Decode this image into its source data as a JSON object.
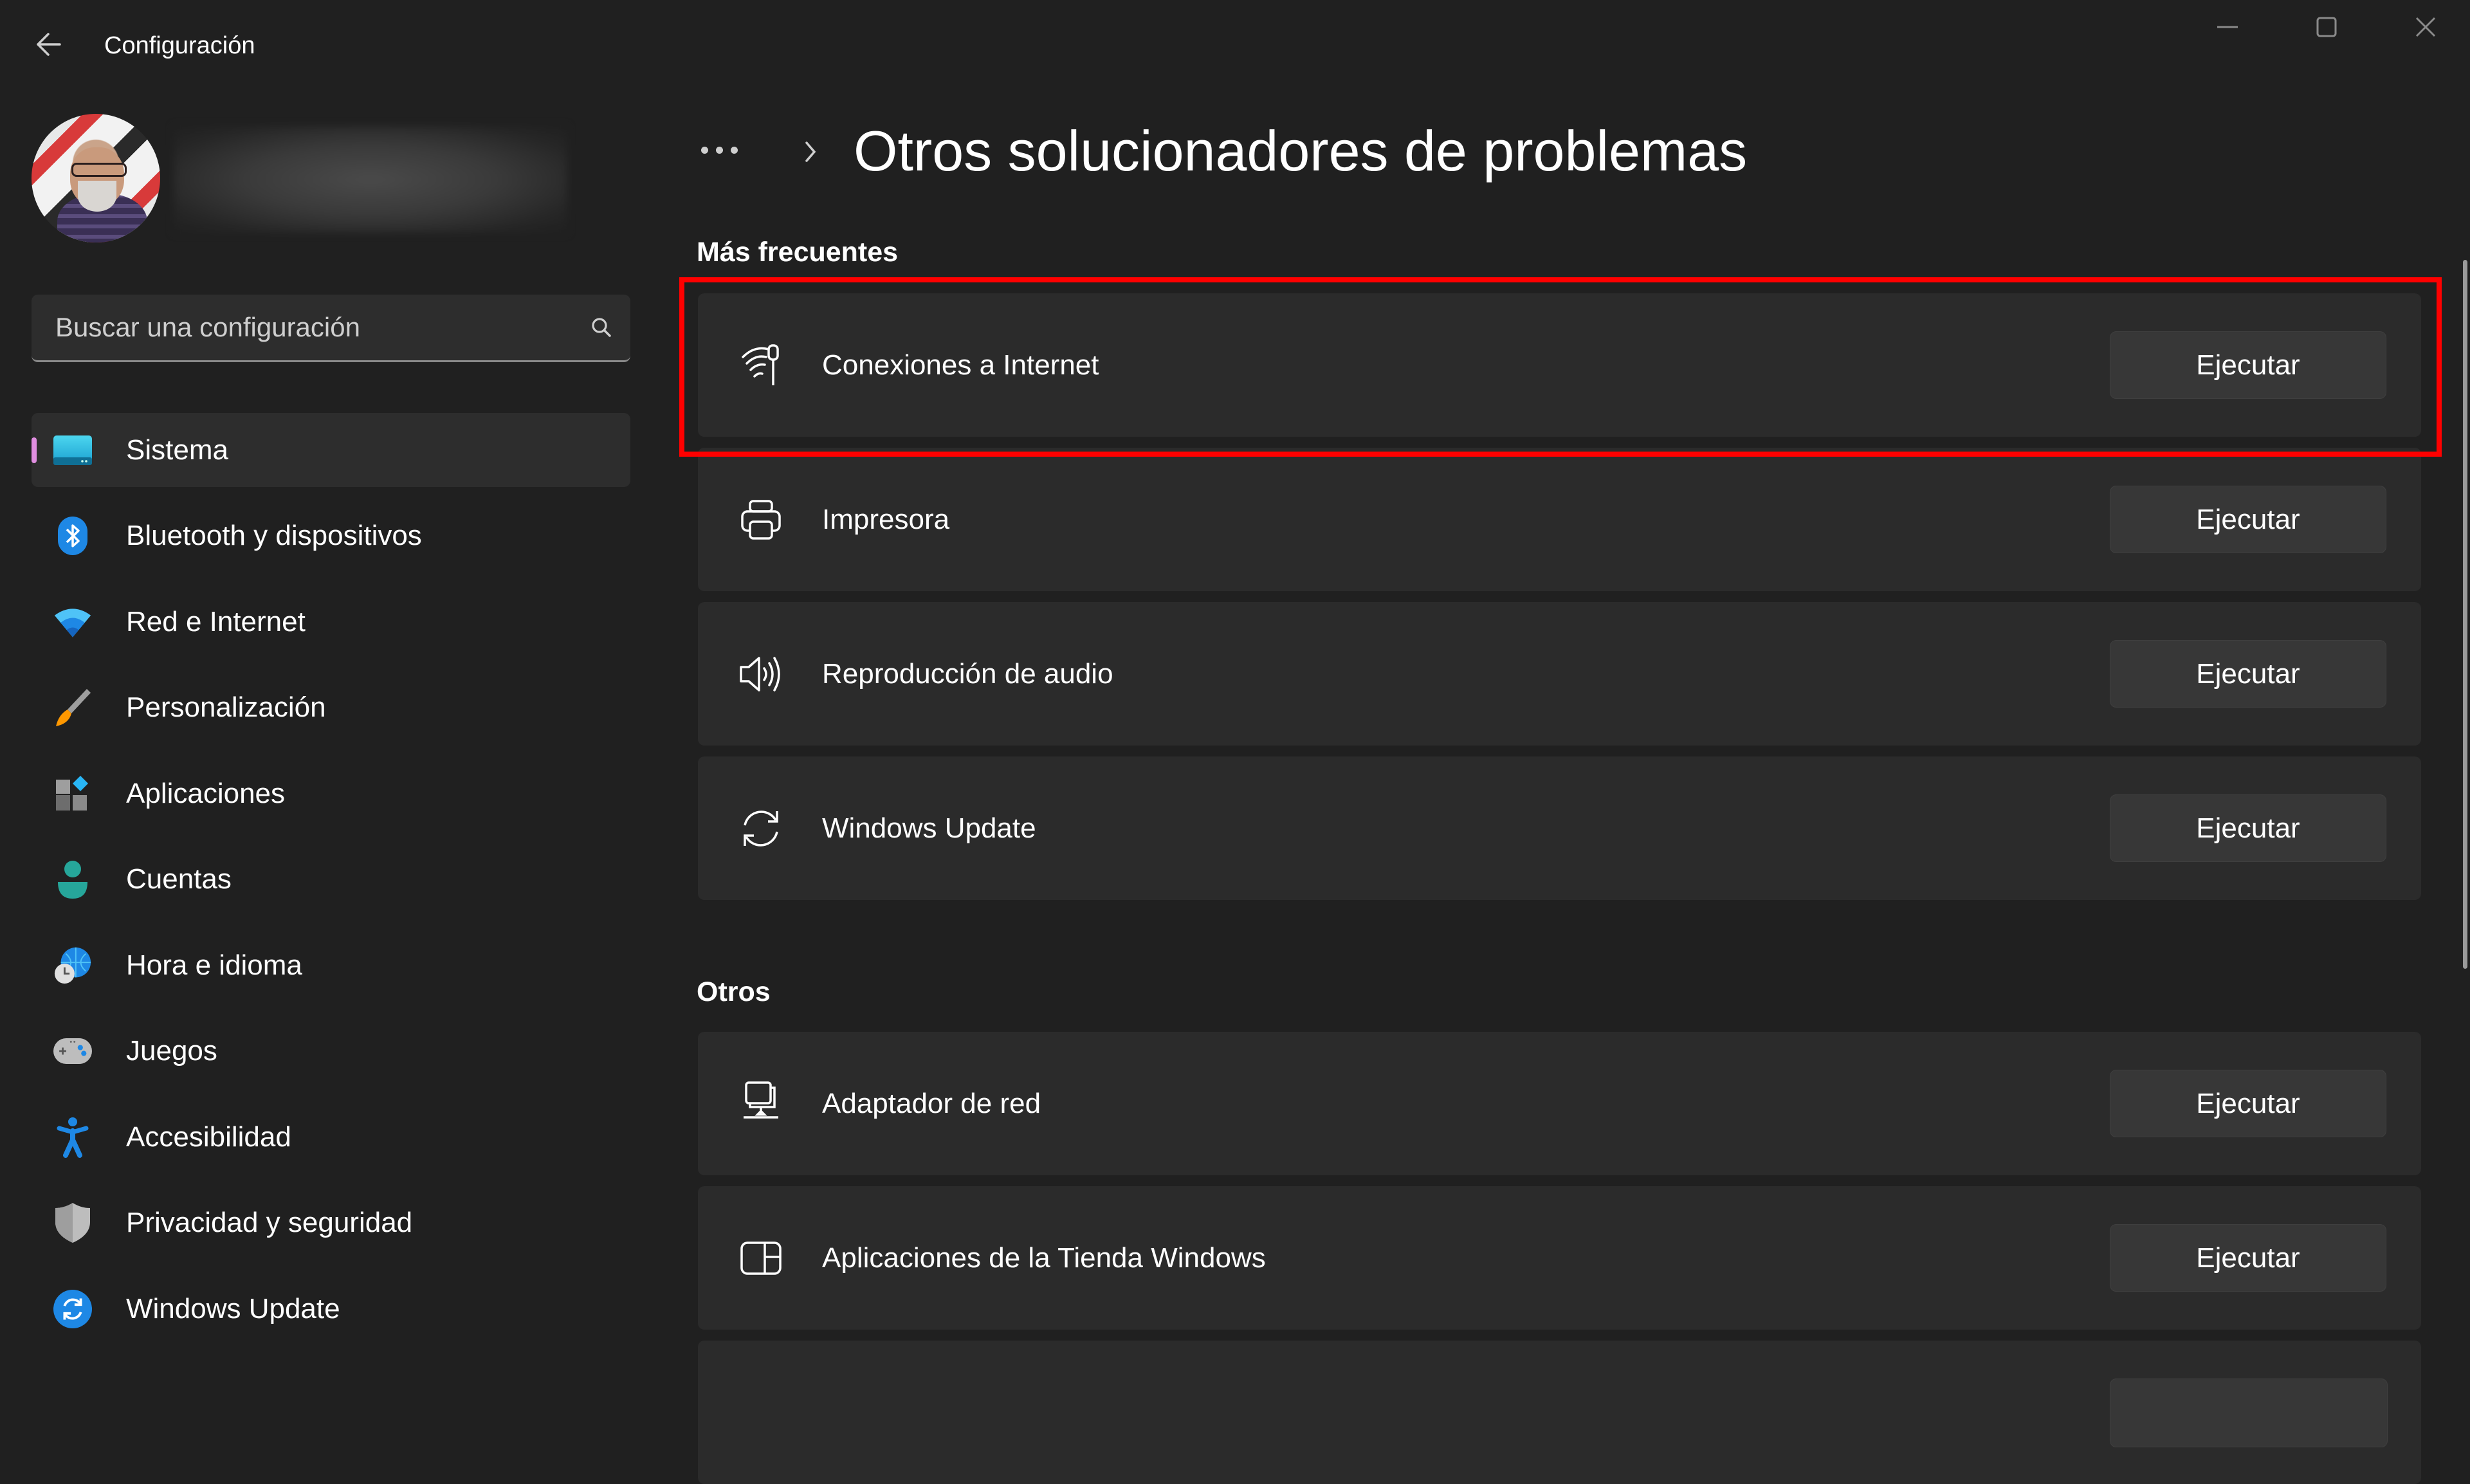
{
  "window": {
    "title": "Configuración",
    "controls": {
      "minimize": "minimize-icon",
      "maximize": "maximize-icon",
      "close": "close-icon"
    }
  },
  "profile": {
    "name": ""
  },
  "search": {
    "placeholder": "Buscar una configuración",
    "value": ""
  },
  "sidebar": {
    "selected": "Sistema",
    "accent_color": "#e08ee0",
    "items": [
      {
        "label": "Sistema",
        "icon": "monitor-icon"
      },
      {
        "label": "Bluetooth y dispositivos",
        "icon": "bluetooth-icon"
      },
      {
        "label": "Red e Internet",
        "icon": "wifi-icon"
      },
      {
        "label": "Personalización",
        "icon": "paintbrush-icon"
      },
      {
        "label": "Aplicaciones",
        "icon": "apps-icon"
      },
      {
        "label": "Cuentas",
        "icon": "person-icon"
      },
      {
        "label": "Hora e idioma",
        "icon": "globe-clock-icon"
      },
      {
        "label": "Juegos",
        "icon": "gamepad-icon"
      },
      {
        "label": "Accesibilidad",
        "icon": "accessibility-icon"
      },
      {
        "label": "Privacidad y seguridad",
        "icon": "shield-icon"
      },
      {
        "label": "Windows Update",
        "icon": "sync-icon"
      }
    ]
  },
  "main": {
    "breadcrumb_more": "...",
    "title": "Otros solucionadores de problemas",
    "sections": [
      {
        "title": "Más frecuentes",
        "items": [
          {
            "label": "Conexiones a Internet",
            "icon": "wifi-signal-icon",
            "button": "Ejecutar",
            "highlighted": true
          },
          {
            "label": "Impresora",
            "icon": "printer-icon",
            "button": "Ejecutar"
          },
          {
            "label": "Reproducción de audio",
            "icon": "speaker-icon",
            "button": "Ejecutar"
          },
          {
            "label": "Windows Update",
            "icon": "sync-icon",
            "button": "Ejecutar"
          }
        ]
      },
      {
        "title": "Otros",
        "items": [
          {
            "label": "Adaptador de red",
            "icon": "network-adapter-icon",
            "button": "Ejecutar"
          },
          {
            "label": "Aplicaciones de la Tienda Windows",
            "icon": "store-apps-icon",
            "button": "Ejecutar"
          }
        ]
      }
    ],
    "highlight_color": "#ff0000"
  }
}
